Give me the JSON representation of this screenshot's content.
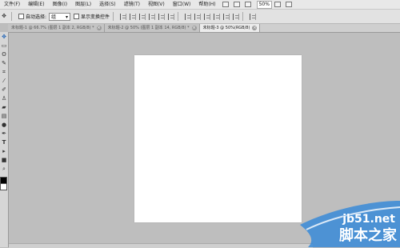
{
  "menubar": {
    "items": [
      "文件(F)",
      "编辑(E)",
      "图像(I)",
      "图层(L)",
      "选择(S)",
      "滤镜(T)",
      "视图(V)",
      "窗口(W)",
      "帮助(H)"
    ],
    "zoom": "50%"
  },
  "options": {
    "auto_select_label": "自动选择:",
    "auto_select_value": "组",
    "show_transform_label": "显示变换控件"
  },
  "tabs": [
    {
      "label": "未标题-1 @ 66.7% (图层 1 副本 2, RGB/8) *",
      "close": "×",
      "active": false
    },
    {
      "label": "未标题-2 @ 50% (图层 1 副本 14, RGB/8) *",
      "close": "×",
      "active": false
    },
    {
      "label": "未标题-3 @ 50%(RGB/8)",
      "close": "×",
      "active": true
    }
  ],
  "tools": [
    "move-tool",
    "marquee-tool",
    "lasso-tool",
    "brush-tool",
    "brush-tool-2",
    "stamp-tool",
    "eraser-tool",
    "gradient-tool",
    "burn-tool",
    "pen-tool",
    "type-tool",
    "shape-tool",
    "hand-tool",
    "zoom-tool",
    "path-select-tool"
  ],
  "watermark": {
    "url": "jb51.net",
    "text": "脚本之家"
  }
}
